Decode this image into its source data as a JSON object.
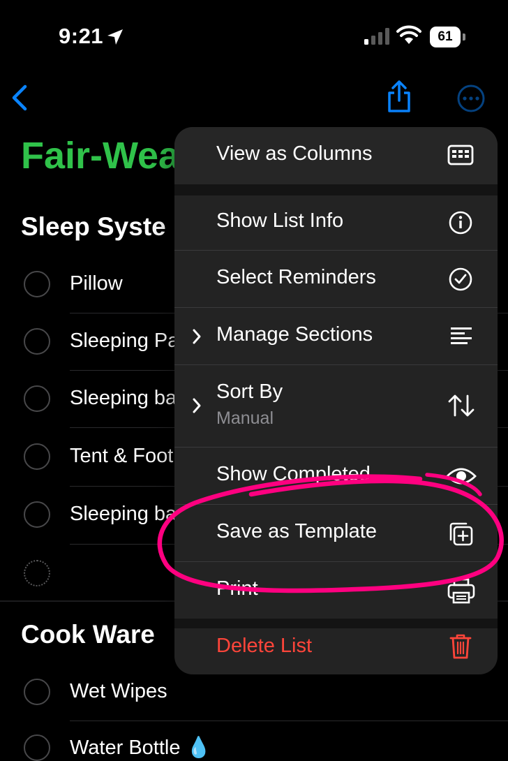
{
  "status_bar": {
    "time": "9:21",
    "battery": "61"
  },
  "nav": {
    "back_icon": "chevron-left-icon",
    "share_icon": "share-icon",
    "more_icon": "ellipsis-circle-icon",
    "accent": "#0a84ff"
  },
  "list": {
    "title": "Fair-Wea",
    "title_color": "#30c24a",
    "sections": [
      {
        "name": "Sleep Syste",
        "items": [
          "Pillow",
          "Sleeping Pa",
          "Sleeping ba",
          "Tent & Foot",
          "Sleeping ba"
        ]
      },
      {
        "name": "Cook Ware",
        "items": [
          "Wet Wipes",
          "Water Bottle 💧"
        ]
      }
    ]
  },
  "menu": {
    "items": [
      {
        "label": "View as Columns",
        "icon": "columns-icon"
      },
      {
        "label": "Show List Info",
        "icon": "info-circle-icon"
      },
      {
        "label": "Select Reminders",
        "icon": "checkmark-circle-icon"
      },
      {
        "label": "Manage Sections",
        "icon": "list-lines-icon",
        "submenu": true
      },
      {
        "label": "Sort By",
        "sublabel": "Manual",
        "icon": "sort-arrows-icon",
        "submenu": true
      },
      {
        "label": "Show Completed",
        "icon": "eye-icon"
      },
      {
        "label": "Save as Template",
        "icon": "plus-square-stack-icon"
      },
      {
        "label": "Print",
        "icon": "printer-icon"
      },
      {
        "label": "Delete List",
        "icon": "trash-icon",
        "destructive": true,
        "color": "#ff453a"
      }
    ],
    "annotation_color": "#ff0080"
  }
}
